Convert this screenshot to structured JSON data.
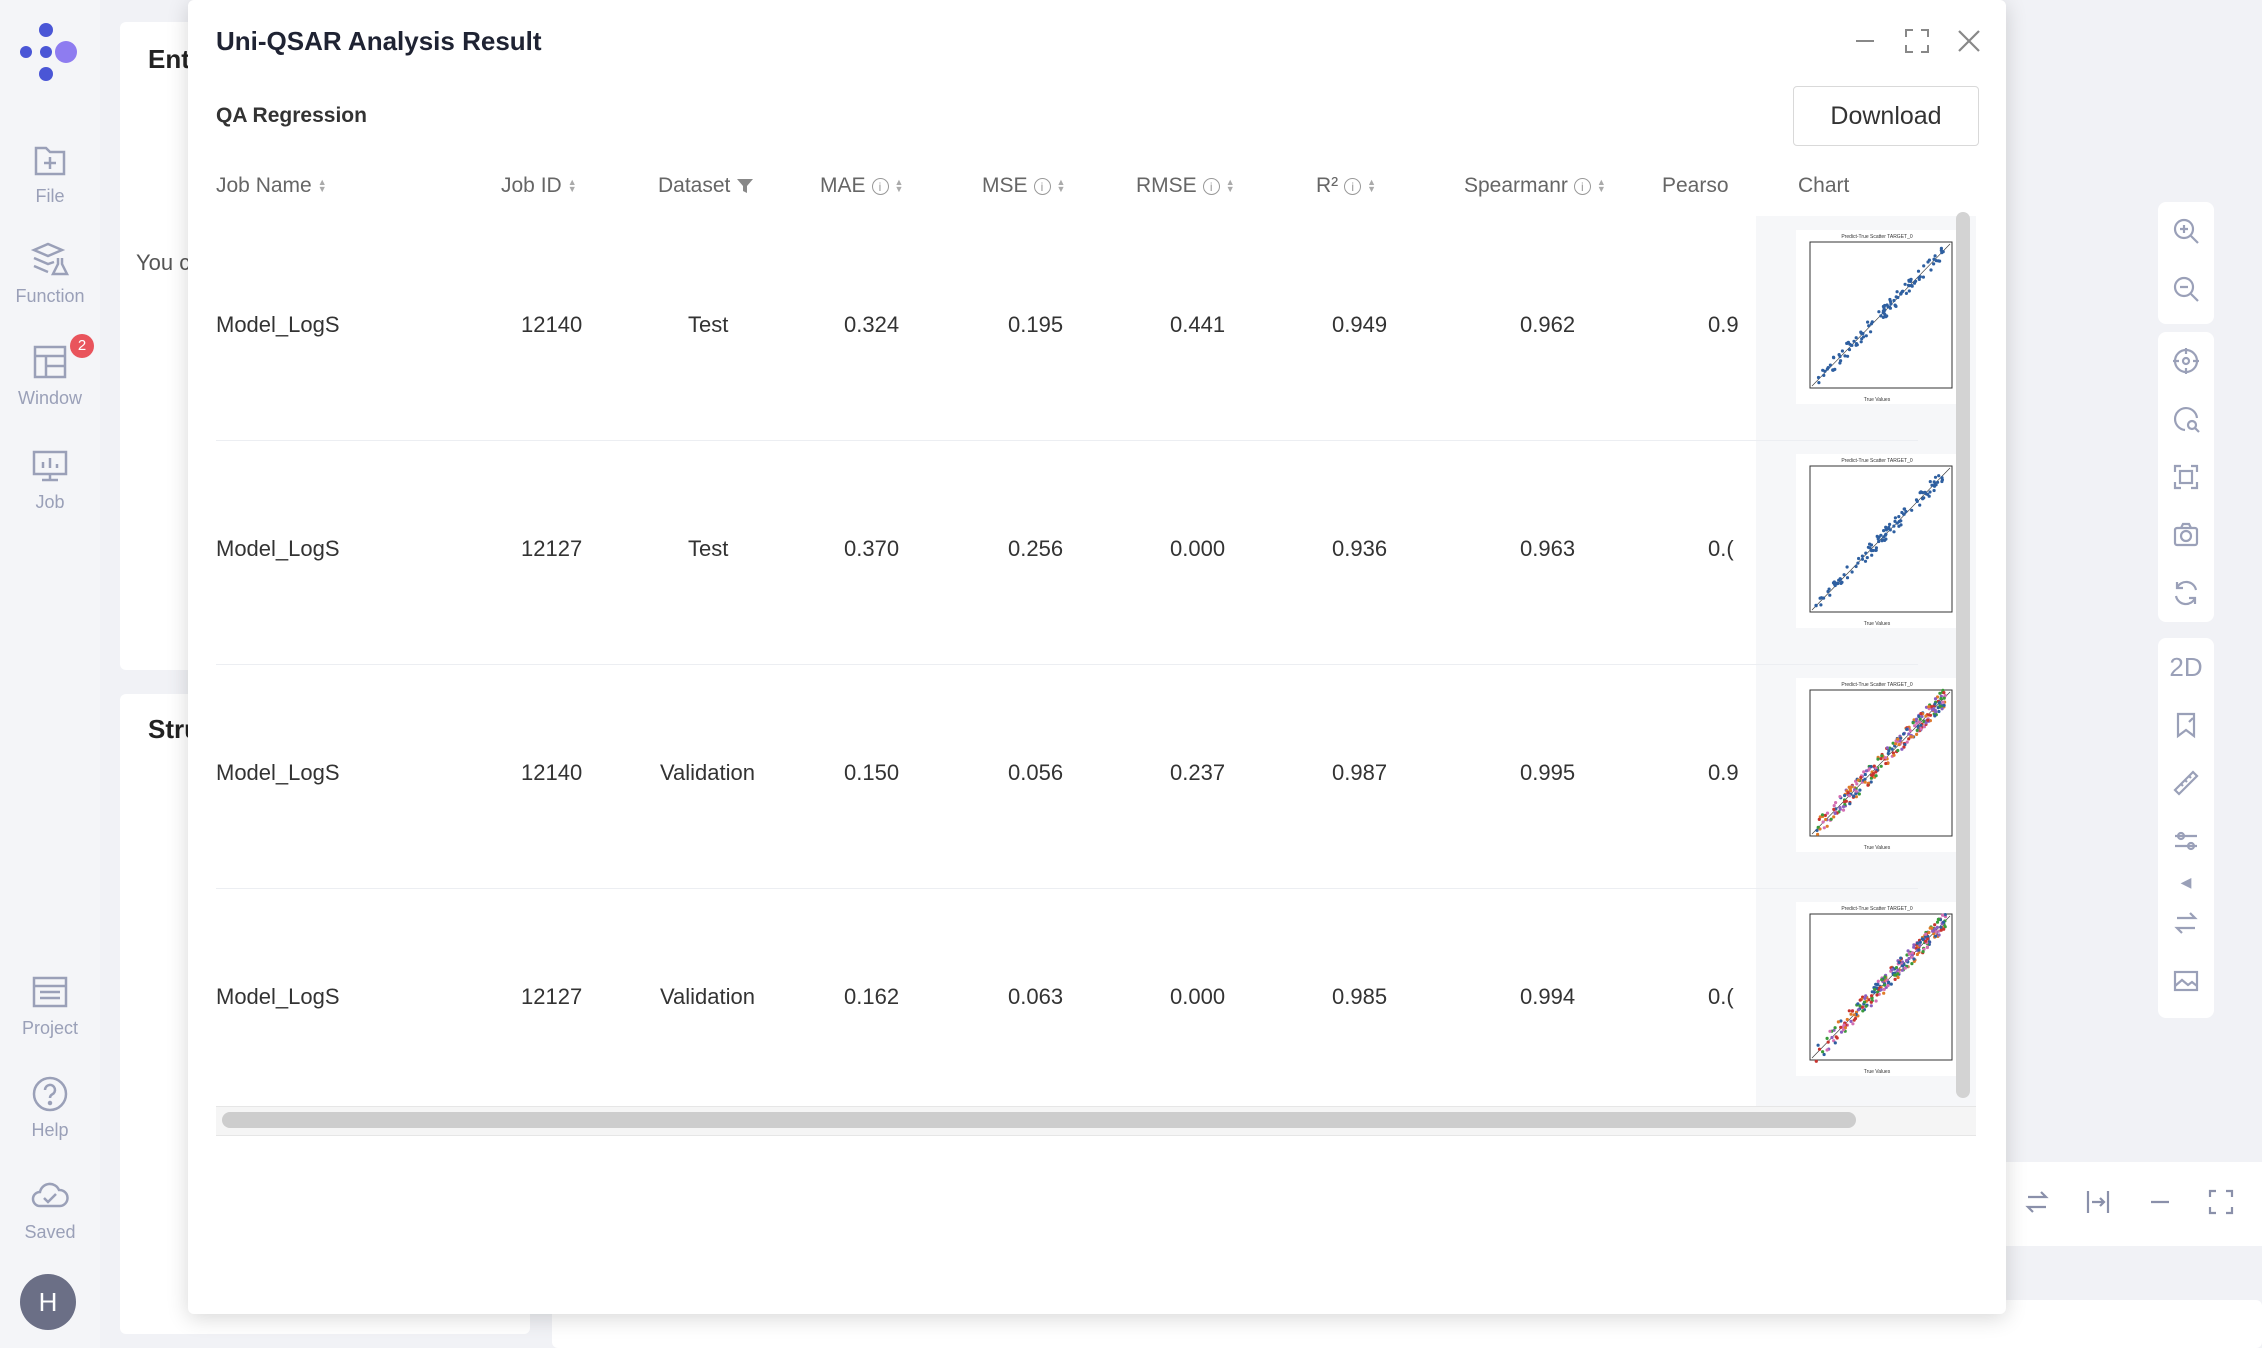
{
  "sidebar": {
    "items": [
      {
        "label": "File",
        "icon": "file-plus-icon"
      },
      {
        "label": "Function",
        "icon": "flask-layers-icon"
      },
      {
        "label": "Window",
        "icon": "window-layout-icon",
        "badge": "2"
      },
      {
        "label": "Job",
        "icon": "monitor-chart-icon"
      },
      {
        "label": "Project",
        "icon": "list-doc-icon"
      },
      {
        "label": "Help",
        "icon": "help-circle-icon"
      },
      {
        "label": "Saved",
        "icon": "cloud-check-icon"
      }
    ],
    "avatar_initial": "H"
  },
  "background": {
    "panel1_label": "Ent",
    "panel1_text": "You c",
    "panel2_label": "Stru"
  },
  "right_toolbar": {
    "two_d_label": "2D"
  },
  "modal": {
    "title": "Uni-QSAR Analysis Result",
    "subtitle": "QA Regression",
    "download_label": "Download",
    "columns": [
      "Job Name",
      "Job ID",
      "Dataset",
      "MAE",
      "MSE",
      "RMSE",
      "R²",
      "Spearmanr",
      "Pearso",
      "Chart"
    ],
    "rows": [
      {
        "job_name": "Model_LogS",
        "job_id": "12140",
        "dataset": "Test",
        "mae": "0.324",
        "mse": "0.195",
        "rmse": "0.441",
        "r2": "0.949",
        "spearmanr": "0.962",
        "pearson": "0.9",
        "chart_title": "Predict-True Scatter TARGET_0"
      },
      {
        "job_name": "Model_LogS",
        "job_id": "12127",
        "dataset": "Test",
        "mae": "0.370",
        "mse": "0.256",
        "rmse": "0.000",
        "r2": "0.936",
        "spearmanr": "0.963",
        "pearson": "0.(",
        "chart_title": "Predict-True Scatter TARGET_0"
      },
      {
        "job_name": "Model_LogS",
        "job_id": "12140",
        "dataset": "Validation",
        "mae": "0.150",
        "mse": "0.056",
        "rmse": "0.237",
        "r2": "0.987",
        "spearmanr": "0.995",
        "pearson": "0.9",
        "chart_title": "Predict-True Scatter TARGET_0"
      },
      {
        "job_name": "Model_LogS",
        "job_id": "12127",
        "dataset": "Validation",
        "mae": "0.162",
        "mse": "0.063",
        "rmse": "0.000",
        "r2": "0.985",
        "spearmanr": "0.994",
        "pearson": "0.(",
        "chart_title": "Predict-True Scatter TARGET_0"
      }
    ]
  },
  "colors": {
    "accent": "#6c63d8",
    "logo_blue": "#4a56d6",
    "logo_purple": "#8e7cf0",
    "badge": "#e9545c",
    "scatter_blue": "#2e5fa0"
  }
}
